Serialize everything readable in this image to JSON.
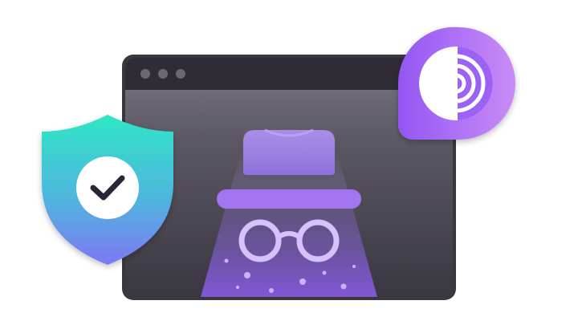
{
  "illustration": {
    "browser_window": {
      "window_controls": [
        "dot",
        "dot",
        "dot"
      ],
      "icon": "incognito-spy-icon"
    },
    "shield_badge": {
      "icon": "checkmark-icon"
    },
    "tor_badge": {
      "icon": "tor-onion-icon"
    }
  },
  "colors": {
    "window_frame": "#3f3c46",
    "window_titlebar": "#2f2c35",
    "window_body_top": "#6b6874",
    "window_body_bottom": "#3d3a44",
    "accent_purple": "#9b6cf0",
    "accent_light_purple": "#c4a8ff",
    "shield_top": "#2fe0c8",
    "shield_bottom": "#7a7cf5",
    "tor_badge_left": "#9a5cf5",
    "tor_badge_right": "#c98df8"
  }
}
